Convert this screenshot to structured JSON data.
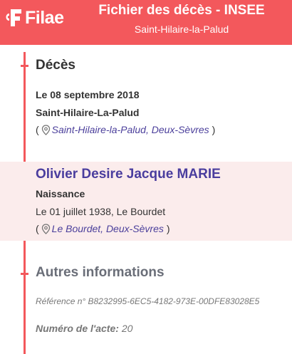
{
  "header": {
    "logo_text": "Filae",
    "title": "Fichier des décès - INSEE",
    "subtitle": "Saint-Hilaire-la-Palud",
    "color": "#f3585c"
  },
  "deces": {
    "title": "Décès",
    "date": "Le 08 septembre 2018",
    "place": "Saint-Hilaire-La-Palud",
    "place_link": "Saint-Hilaire-la-Palud, Deux-Sèvres",
    "open_paren": "(",
    "close_paren": ")"
  },
  "person": {
    "name": "Olivier Desire Jacque MARIE",
    "naissance_label": "Naissance",
    "naissance_date": "Le 01 juillet 1938, Le Bourdet",
    "place_link": "Le Bourdet, Deux-Sèvres",
    "open_paren": "(",
    "close_paren": ")"
  },
  "autres": {
    "title": "Autres informations",
    "reference": "Référence n° B8232995-6EC5-4182-973E-00DFE83028E5",
    "acte_label": "Numéro de l'acte:",
    "acte_value": "20"
  },
  "colors": {
    "accent": "#f3585c",
    "link": "#4b3f9b",
    "highlight_bg": "#fbecec"
  }
}
